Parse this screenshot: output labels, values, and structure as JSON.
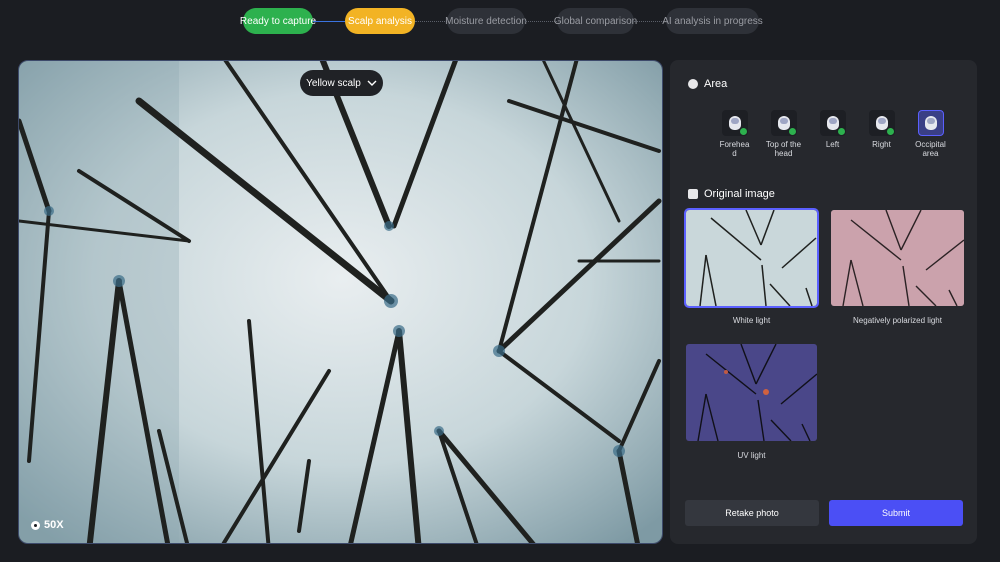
{
  "stepper": {
    "steps": [
      {
        "label": "Ready to capture",
        "state": "done"
      },
      {
        "label": "Scalp analysis",
        "state": "active"
      },
      {
        "label": "Moisture detection",
        "state": "todo"
      },
      {
        "label": "Global comparison",
        "state": "todo"
      },
      {
        "label": "AI analysis in progress",
        "state": "todo"
      }
    ]
  },
  "viewer": {
    "scalp_selector": "Yellow scalp",
    "magnification": "50X"
  },
  "panel": {
    "area_title": "Area",
    "areas": [
      {
        "label": "Forehead",
        "captured": true
      },
      {
        "label": "Top of the head",
        "captured": true
      },
      {
        "label": "Left",
        "captured": true
      },
      {
        "label": "Right",
        "captured": true
      },
      {
        "label": "Occipital area",
        "captured": false,
        "selected": true
      }
    ],
    "original_title": "Original image",
    "images": [
      {
        "label": "White light",
        "selected": true
      },
      {
        "label": "Negatively polarized light",
        "selected": false
      },
      {
        "label": "UV light",
        "selected": false
      }
    ],
    "retake_label": "Retake photo",
    "submit_label": "Submit"
  },
  "colors": {
    "done": "#2db14e",
    "active": "#f2b324",
    "accent": "#4b4ff5",
    "panel_bg": "#26282d"
  }
}
